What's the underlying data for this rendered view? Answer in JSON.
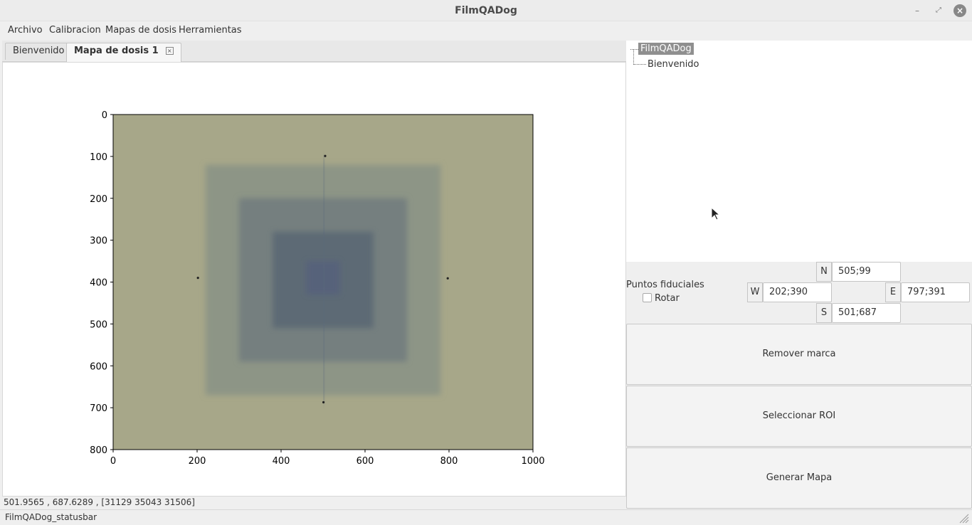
{
  "window": {
    "title": "FilmQADog"
  },
  "menu": {
    "items": [
      "Archivo",
      "Calibracion",
      "Mapas de dosis",
      "Herramientas"
    ]
  },
  "tabs": [
    {
      "label": "Bienvenido"
    },
    {
      "label": "Mapa de dosis 1"
    }
  ],
  "plot": {
    "xticks": [
      "0",
      "200",
      "400",
      "600",
      "800",
      "1000"
    ],
    "yticks": [
      "0",
      "100",
      "200",
      "300",
      "400",
      "500",
      "600",
      "700",
      "800"
    ],
    "film_color": "#a7a789",
    "squares": [
      {
        "x": [
          220,
          780
        ],
        "y": [
          120,
          670
        ],
        "color": "#8d9586"
      },
      {
        "x": [
          300,
          700
        ],
        "y": [
          200,
          590
        ],
        "color": "#747f7f"
      },
      {
        "x": [
          380,
          620
        ],
        "y": [
          280,
          510
        ],
        "color": "#5d6a75"
      },
      {
        "x": [
          460,
          540
        ],
        "y": [
          350,
          430
        ],
        "color": "#56627a"
      }
    ],
    "fiducials": [
      {
        "name": "N",
        "x": 505,
        "y": 99
      },
      {
        "name": "W",
        "x": 202,
        "y": 390
      },
      {
        "name": "E",
        "x": 797,
        "y": 391
      },
      {
        "name": "S",
        "x": 501,
        "y": 687
      }
    ]
  },
  "coords_readout": "501.9565 , 687.6289 , [31129 35043 31506]",
  "tree": {
    "root": "FilmQADog",
    "child": "Bienvenido"
  },
  "fiducials_panel": {
    "label": "Puntos fiduciales",
    "rotate_label": "Rotar",
    "n": {
      "label": "N",
      "value": "505;99"
    },
    "w": {
      "label": "W",
      "value": "202;390"
    },
    "e": {
      "label": "E",
      "value": "797;391"
    },
    "s": {
      "label": "S",
      "value": "501;687"
    }
  },
  "buttons": {
    "remove_mark": "Remover marca",
    "select_roi": "Seleccionar ROI",
    "generate_map": "Generar Mapa"
  },
  "statusbar": {
    "text": "FilmQADog_statusbar"
  }
}
